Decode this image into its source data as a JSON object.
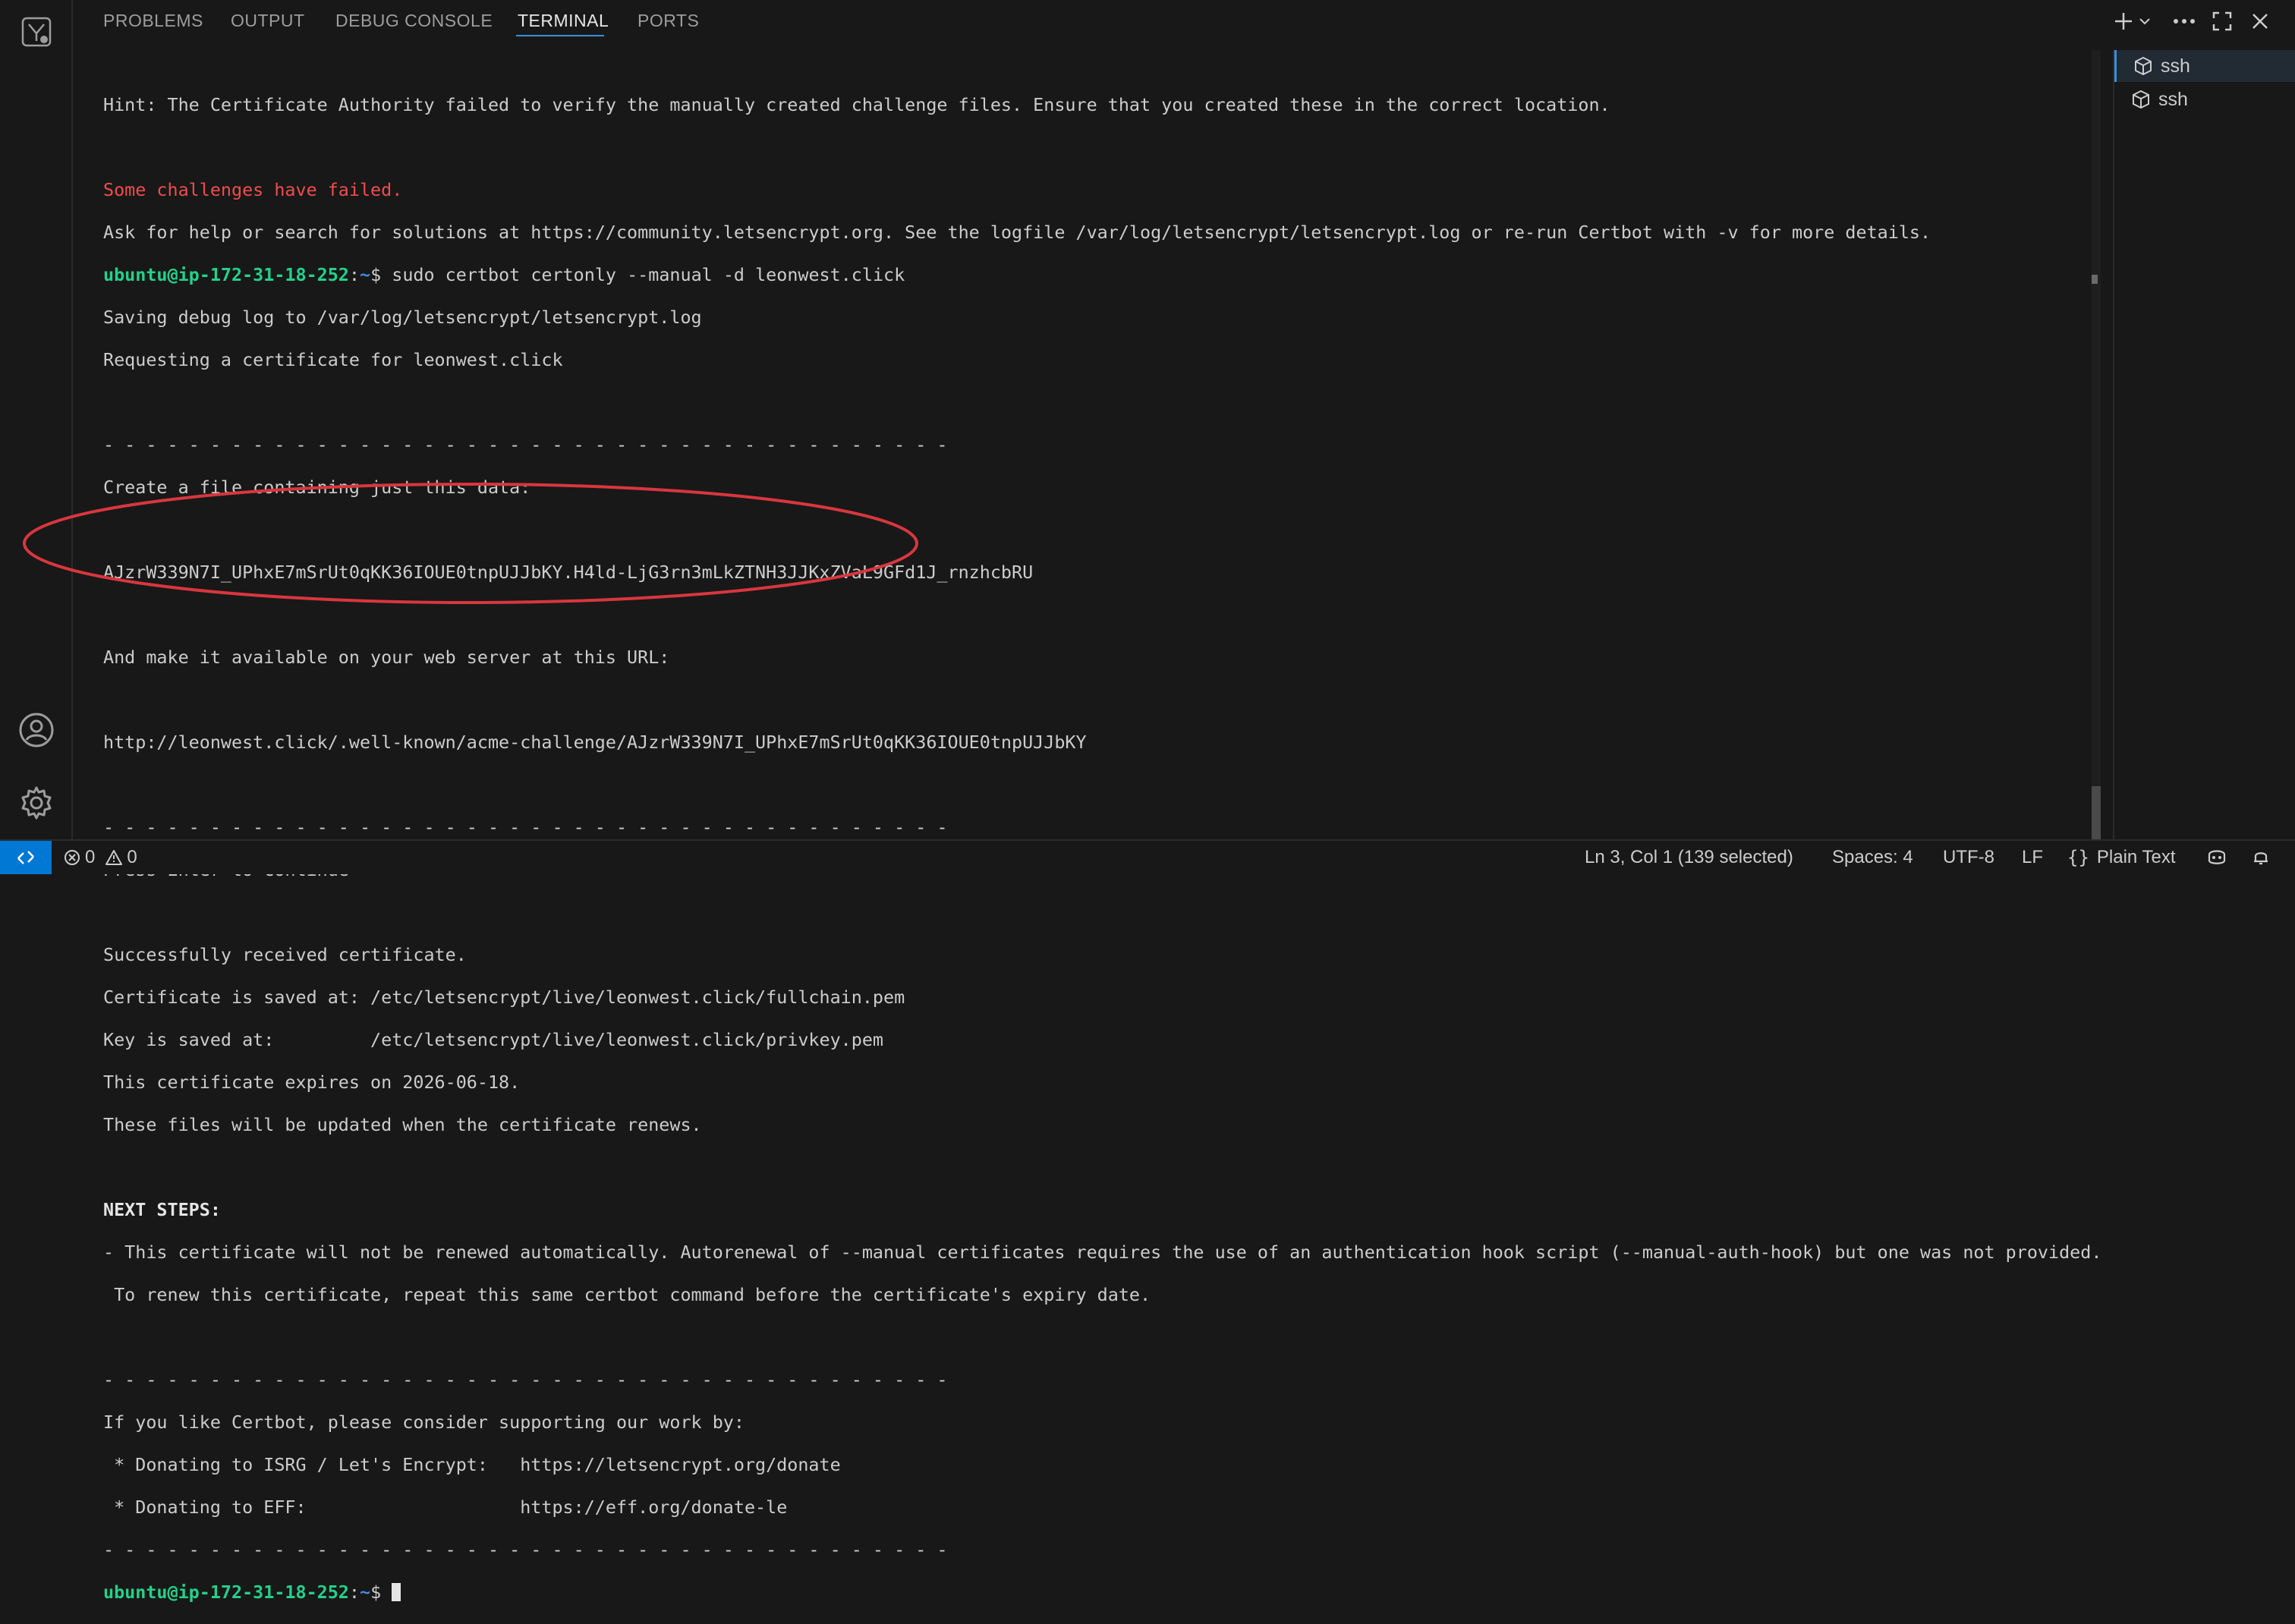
{
  "panel": {
    "tabs": [
      {
        "label": "PROBLEMS"
      },
      {
        "label": "OUTPUT"
      },
      {
        "label": "DEBUG CONSOLE"
      },
      {
        "label": "TERMINAL"
      },
      {
        "label": "PORTS"
      }
    ],
    "active_tab": "TERMINAL",
    "header_icons": [
      "plus-icon",
      "chevron-down-icon",
      "ellipsis-icon",
      "maximize-icon",
      "close-icon"
    ]
  },
  "activity_icons": [
    "remote-explorer-icon",
    "account-icon",
    "settings-gear-icon"
  ],
  "terminal": {
    "lines": {
      "l1": "Hint: The Certificate Authority failed to verify the manually created challenge files. Ensure that you created these in the correct location.",
      "l2": "Some challenges have failed.",
      "l3": "Ask for help or search for solutions at https://community.letsencrypt.org. See the logfile /var/log/letsencrypt/letsencrypt.log or re-run Certbot with -v for more details.",
      "prompt_user": "ubuntu@ip-172-31-18-252",
      "prompt_colon": ":",
      "prompt_path": "~",
      "prompt_sign": "$ ",
      "cmd": "sudo certbot certonly --manual -d leonwest.click",
      "l5": "Saving debug log to /var/log/letsencrypt/letsencrypt.log",
      "l6": "Requesting a certificate for leonwest.click",
      "sep": "- - - - - - - - - - - - - - - - - - - - - - - - - - - - - - - - - - - - - - - -",
      "l8": "Create a file containing just this data:",
      "l9": "AJzrW339N7I_UPhxE7mSrUt0qKK36IOUE0tnpUJJbKY.H4ld-LjG3rn3mLkZTNH3JJKxZVaL9GFd1J_rnzhcbRU",
      "l10": "And make it available on your web server at this URL:",
      "l11": "http://leonwest.click/.well-known/acme-challenge/AJzrW339N7I_UPhxE7mSrUt0qKK36IOUE0tnpUJJbKY",
      "l12": "Press Enter to Continue",
      "l13": "Successfully received certificate.",
      "l14": "Certificate is saved at: /etc/letsencrypt/live/leonwest.click/fullchain.pem",
      "l15": "Key is saved at:         /etc/letsencrypt/live/leonwest.click/privkey.pem",
      "l16": "This certificate expires on 2026-06-18.",
      "l17": "These files will be updated when the certificate renews.",
      "l18": "NEXT STEPS:",
      "l19": "- This certificate will not be renewed automatically. Autorenewal of --manual certificates requires the use of an authentication hook script (--manual-auth-hook) but one was not provided.",
      "l20": " To renew this certificate, repeat this same certbot command before the certificate's expiry date.",
      "l21": "If you like Certbot, please consider supporting our work by:",
      "l22": " * Donating to ISRG / Let's Encrypt:   https://letsencrypt.org/donate",
      "l23": " * Donating to EFF:                    https://eff.org/donate-le"
    }
  },
  "terminal_list": [
    {
      "label": "ssh",
      "active": true
    },
    {
      "label": "ssh",
      "active": false
    }
  ],
  "status_bar": {
    "errors": "0",
    "warnings": "0",
    "position": "Ln 3, Col 1 (139 selected)",
    "spaces": "Spaces: 4",
    "encoding": "UTF-8",
    "eol": "LF",
    "language_icon": "{}",
    "language": "Plain Text"
  },
  "colors": {
    "accent": "#0078d4",
    "prompt_green": "#23d18b",
    "path_blue": "#3b8eea",
    "error_red": "#f14c4c",
    "annotation_red": "#d9363e"
  }
}
